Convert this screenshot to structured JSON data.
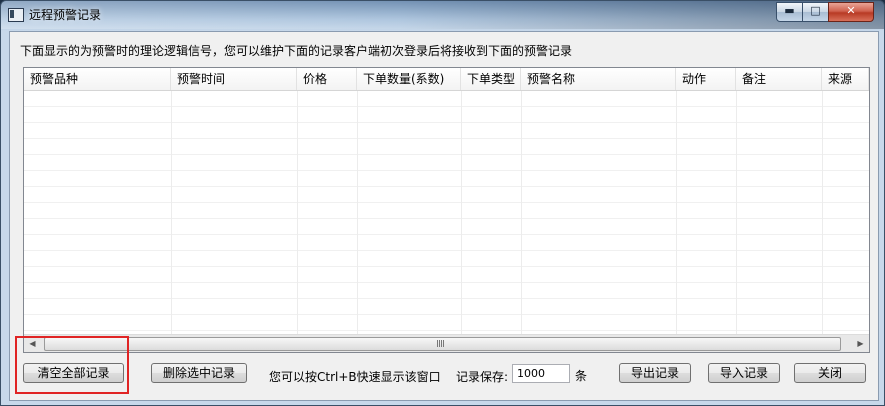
{
  "window": {
    "title": "远程预警记录",
    "controls": {
      "minimize": "▬",
      "maximize": "□",
      "close": "✕"
    }
  },
  "info_text": "下面显示的为预警时的理论逻辑信号，您可以维护下面的记录客户端初次登录后将接收到下面的预警记录",
  "table": {
    "columns": [
      "预警品种",
      "预警时间",
      "价格",
      "下单数量(系数)",
      "下单类型",
      "预警名称",
      "动作",
      "备注",
      "来源"
    ],
    "rows": []
  },
  "scrollbar": {
    "left_arrow": "◀",
    "right_arrow": "▶"
  },
  "buttons": {
    "clear_all": "清空全部记录",
    "delete_selected": "删除选中记录",
    "export": "导出记录",
    "import": "导入记录",
    "close": "关闭"
  },
  "hint": "您可以按Ctrl+B快速显示该窗口",
  "keep": {
    "label": "记录保存:",
    "value": "1000",
    "unit": "条"
  },
  "colors": {
    "highlight_box": "#e02424"
  }
}
